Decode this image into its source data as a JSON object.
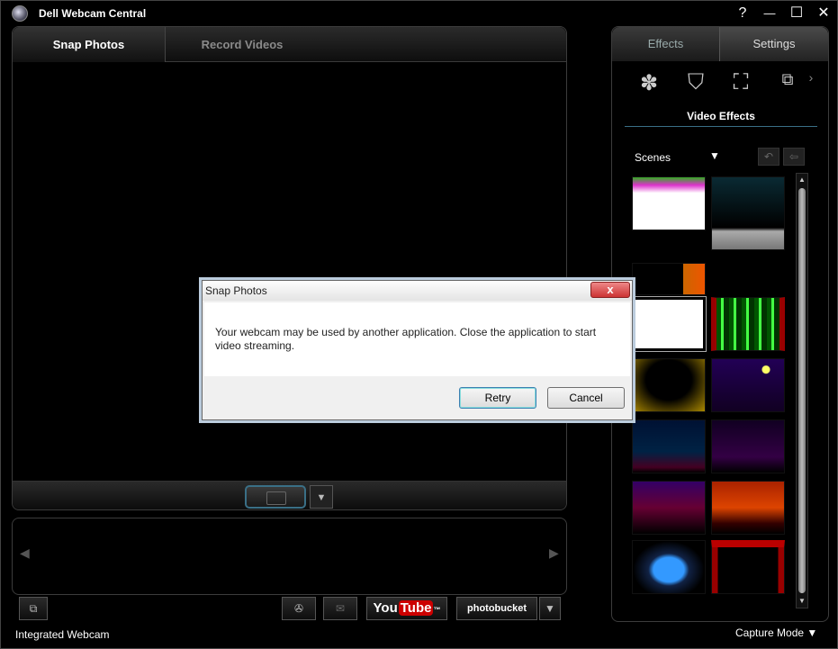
{
  "window": {
    "title": "Dell Webcam Central",
    "controls": {
      "help": "?",
      "minimize": "—",
      "maximize": "☐",
      "close": "✕"
    }
  },
  "left_tabs": [
    {
      "label": "Snap Photos",
      "active": true
    },
    {
      "label": "Record Videos",
      "active": false
    }
  ],
  "right_tabs": [
    {
      "label": "Effects",
      "active": true
    },
    {
      "label": "Settings",
      "active": false
    }
  ],
  "effects": {
    "section_label": "Video Effects",
    "icons": [
      "palette-icon",
      "mask-icon",
      "presentation-icon",
      "overlay-icon"
    ],
    "more_arrow": "›",
    "dropdown": {
      "label": "Scenes",
      "arrow": "▼"
    },
    "thumbnails": [
      "party",
      "night-bridge",
      "room",
      "photo-frame",
      "green-bars",
      "golden-glow",
      "moon-night",
      "starry-city",
      "night-city",
      "purple-stars",
      "red-skyline",
      "ufo",
      "theater-curtain"
    ]
  },
  "filmstrip": {
    "left_arrow": "◀",
    "right_arrow": "▶"
  },
  "bottom_buttons": {
    "youtube_you": "You",
    "youtube_tube": "Tube",
    "youtube_tm": "™",
    "photobucket": "photobucket",
    "menu_arrow": "▼"
  },
  "status": {
    "camera": "Integrated Webcam",
    "mode": "Capture Mode",
    "mode_arrow": "▼"
  },
  "dialog": {
    "title": "Snap Photos",
    "close": "x",
    "message": "Your webcam may be used by another application. Close the application to start video streaming.",
    "retry": "Retry",
    "cancel": "Cancel"
  }
}
